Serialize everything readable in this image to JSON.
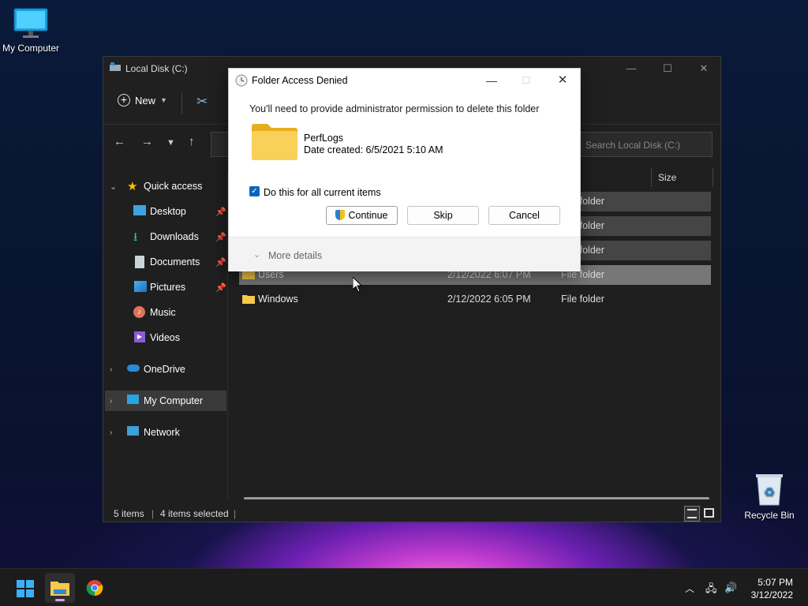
{
  "desktop": {
    "icons": [
      {
        "label": "My Computer"
      },
      {
        "label": "Recycle Bin"
      }
    ]
  },
  "explorer": {
    "title": "Local Disk (C:)",
    "new_label": "New",
    "search_placeholder": "Search Local Disk (C:)",
    "columns": {
      "size": "Size"
    },
    "sidebar": [
      {
        "label": "Quick access",
        "icon": "star-icon"
      },
      {
        "label": "Desktop",
        "icon": "desktop-icon",
        "pinned": true
      },
      {
        "label": "Downloads",
        "icon": "download-icon",
        "pinned": true
      },
      {
        "label": "Documents",
        "icon": "documents-icon",
        "pinned": true
      },
      {
        "label": "Pictures",
        "icon": "pictures-icon",
        "pinned": true
      },
      {
        "label": "Music",
        "icon": "music-icon"
      },
      {
        "label": "Videos",
        "icon": "videos-icon"
      },
      {
        "label": "OneDrive",
        "icon": "cloud-icon"
      },
      {
        "label": "My Computer",
        "icon": "computer-icon",
        "selected": true
      },
      {
        "label": "Network",
        "icon": "network-icon"
      }
    ],
    "rows": [
      {
        "name": "",
        "date": "",
        "type": "older"
      },
      {
        "name": "",
        "date": "",
        "type": "older"
      },
      {
        "name": "",
        "date": "",
        "type": "older"
      },
      {
        "name": "Users",
        "date": "2/12/2022 6:07 PM",
        "type": "File folder"
      },
      {
        "name": "Windows",
        "date": "2/12/2022 6:05 PM",
        "type": "File folder"
      }
    ],
    "status": {
      "items": "5 items",
      "selected": "4 items selected"
    }
  },
  "dialog": {
    "title": "Folder Access Denied",
    "message": "You'll need to provide administrator permission to delete this folder",
    "folder_name": "PerfLogs",
    "folder_date": "Date created: 6/5/2021 5:10 AM",
    "checkbox_label": "Do this for all current items",
    "checkbox_checked": true,
    "continue_label": "Continue",
    "skip_label": "Skip",
    "cancel_label": "Cancel",
    "more_details_label": "More details"
  },
  "taskbar": {
    "time": "5:07 PM",
    "date": "3/12/2022"
  },
  "colors": {
    "accent": "#0067c0",
    "folder": "#f8c94a"
  }
}
